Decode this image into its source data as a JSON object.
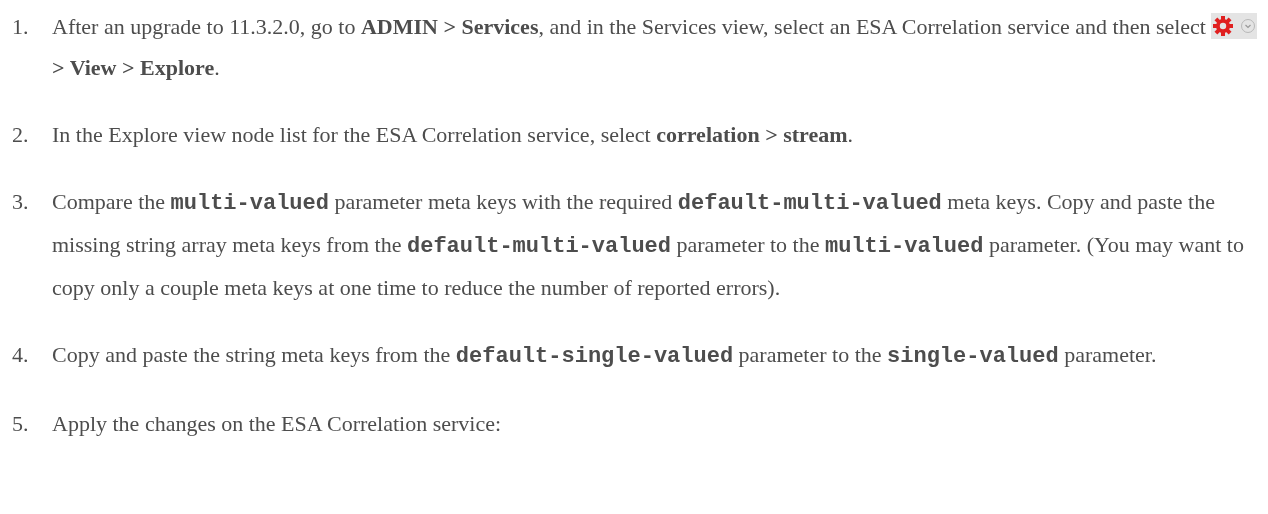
{
  "steps": [
    {
      "number": "1.",
      "segments": [
        {
          "kind": "text",
          "text": "After an upgrade to 11.3.2.0, go to "
        },
        {
          "kind": "bold",
          "text": "ADMIN > Services"
        },
        {
          "kind": "text",
          "text": ", and in the Services view, select an ESA Correlation service and then select "
        },
        {
          "kind": "gear_menu"
        },
        {
          "kind": "bold",
          "text": "> View > Explore"
        },
        {
          "kind": "text",
          "text": "."
        }
      ]
    },
    {
      "number": "2.",
      "segments": [
        {
          "kind": "text",
          "text": "In the Explore view node list for the ESA Correlation service, select "
        },
        {
          "kind": "bold",
          "text": "correlation > stream"
        },
        {
          "kind": "text",
          "text": "."
        }
      ]
    },
    {
      "number": "3.",
      "segments": [
        {
          "kind": "text",
          "text": "Compare the "
        },
        {
          "kind": "code",
          "text": "multi-valued"
        },
        {
          "kind": "text",
          "text": " parameter meta keys with the required "
        },
        {
          "kind": "code",
          "text": "default-multi-valued"
        },
        {
          "kind": "text",
          "text": " meta keys. Copy and paste the missing string array meta keys from the "
        },
        {
          "kind": "code",
          "text": "default-multi-valued"
        },
        {
          "kind": "text",
          "text": " parameter to the "
        },
        {
          "kind": "code",
          "text": "multi-valued"
        },
        {
          "kind": "text",
          "text": " parameter. (You may want to copy only a couple meta keys at one time to reduce the number of reported errors)."
        }
      ]
    },
    {
      "number": "4.",
      "segments": [
        {
          "kind": "text",
          "text": "Copy and paste the string meta keys from the "
        },
        {
          "kind": "code",
          "text": "default-single-valued"
        },
        {
          "kind": "text",
          "text": " parameter to the "
        },
        {
          "kind": "code",
          "text": "single-valued"
        },
        {
          "kind": "text",
          "text": " parameter."
        }
      ]
    },
    {
      "number": "5.",
      "segments": [
        {
          "kind": "text",
          "text": "Apply the changes on the ESA Correlation service:"
        }
      ]
    }
  ]
}
